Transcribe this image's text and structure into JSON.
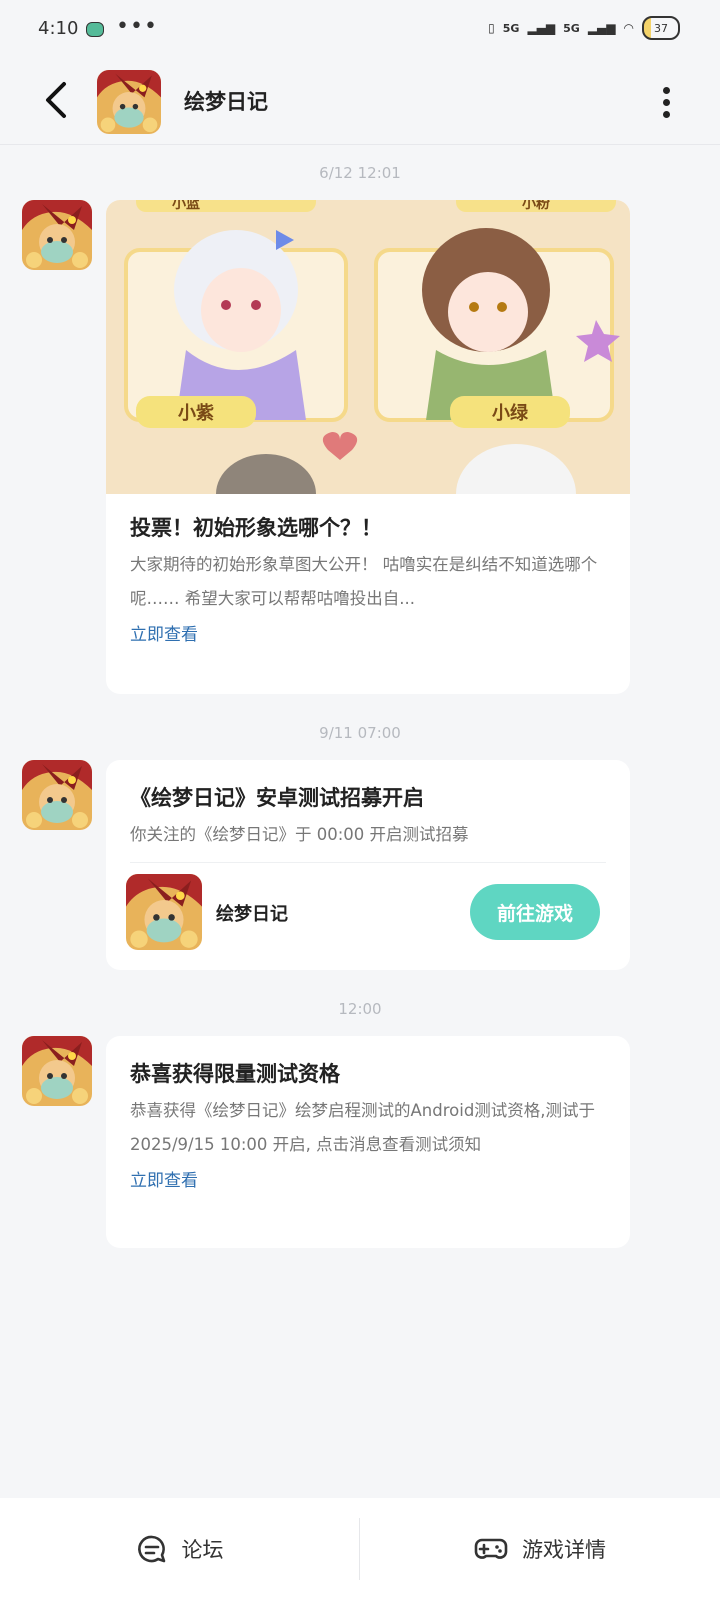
{
  "status_bar": {
    "time": "4:10",
    "dots": "•••",
    "signal1": "5G",
    "signal2": "5G",
    "battery": "37"
  },
  "header": {
    "title": "绘梦日记"
  },
  "messages": [
    {
      "timestamp": "6/12  12:01",
      "banner": {
        "left_label": "小紫",
        "right_label": "小绿",
        "top_left_label": "小蓝",
        "top_right_label": "小粉"
      },
      "title": "投票！初始形象选哪个？！",
      "body": "大家期待的初始形象草图大公开！ 咕噜实在是纠结不知道选哪个呢…… 希望大家可以帮帮咕噜投出自...",
      "link": "立即查看"
    },
    {
      "timestamp": "9/11  07:00",
      "title": "《绘梦日记》安卓测试招募开启",
      "body": "你关注的《绘梦日记》于 00:00 开启测试招募",
      "game_name": "绘梦日记",
      "button": "前往游戏"
    },
    {
      "timestamp": "12:00",
      "title": "恭喜获得限量测试资格",
      "body": "恭喜获得《绘梦日记》绘梦启程测试的Android测试资格,测试于 2025/9/15 10:00 开启, 点击消息查看测试须知",
      "link": "立即查看"
    }
  ],
  "bottom_tabs": [
    {
      "label": "论坛",
      "icon": "forum-icon"
    },
    {
      "label": "游戏详情",
      "icon": "gamepad-icon"
    }
  ],
  "colors": {
    "accent": "#5fd6c2",
    "link": "#2f6fb0",
    "background": "#f5f6f8"
  }
}
